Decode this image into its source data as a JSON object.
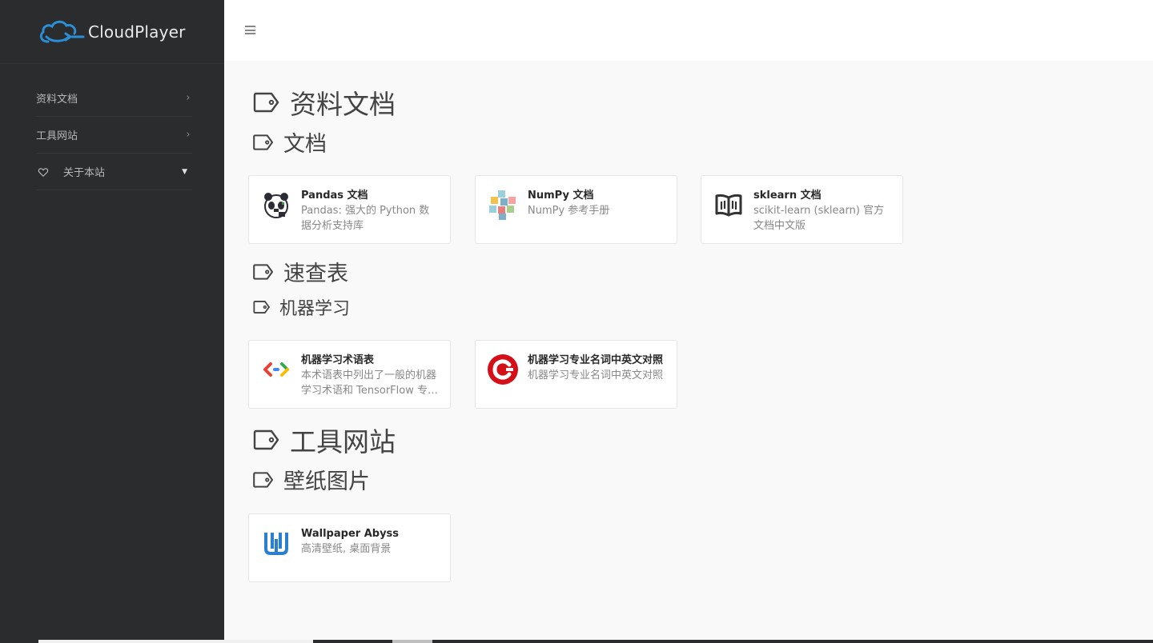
{
  "brand": {
    "name": "CloudPlayer",
    "logo_icon": "cloud-logo-icon",
    "accent": "#2b8fd8"
  },
  "sidebar": {
    "items": [
      {
        "label": "资料文档",
        "indicator": "chevron-right"
      },
      {
        "label": "工具网站",
        "indicator": "chevron-right"
      },
      {
        "label": "关于本站",
        "icon": "heart-icon",
        "indicator": "caret-down"
      }
    ]
  },
  "header": {
    "menu_icon": "hamburger-menu-icon"
  },
  "sections": [
    {
      "title": "资料文档",
      "groups": [
        {
          "title": "文档",
          "cards": [
            {
              "title": "Pandas 文档",
              "desc": "Pandas: 强大的 Python 数据分析支持库",
              "icon": "pandas-logo-icon"
            },
            {
              "title": "NumPy 文档",
              "desc": "NumPy 参考手册",
              "icon": "numpy-cubes-icon"
            },
            {
              "title": "sklearn 文档",
              "desc": "scikit-learn (sklearn) 官方文档中文版",
              "icon": "open-book-icon"
            }
          ]
        },
        {
          "title": "速查表",
          "subgroups": [
            {
              "title": "机器学习",
              "cards": [
                {
                  "title": "机器学习术语表",
                  "desc": "本术语表中列出了一般的机器学习术语和 TensorFlow 专用术语",
                  "icon": "code-brackets-icon"
                },
                {
                  "title": "机器学习专业名词中英文对照",
                  "desc": "机器学习专业名词中英文对照",
                  "icon": "red-c-logo-icon"
                }
              ]
            }
          ]
        }
      ]
    },
    {
      "title": "工具网站",
      "groups": [
        {
          "title": "壁纸图片",
          "cards": [
            {
              "title": "Wallpaper Abyss",
              "desc": "高清壁纸, 桌面背景",
              "icon": "wallpaper-abyss-w-icon"
            }
          ]
        }
      ]
    }
  ]
}
